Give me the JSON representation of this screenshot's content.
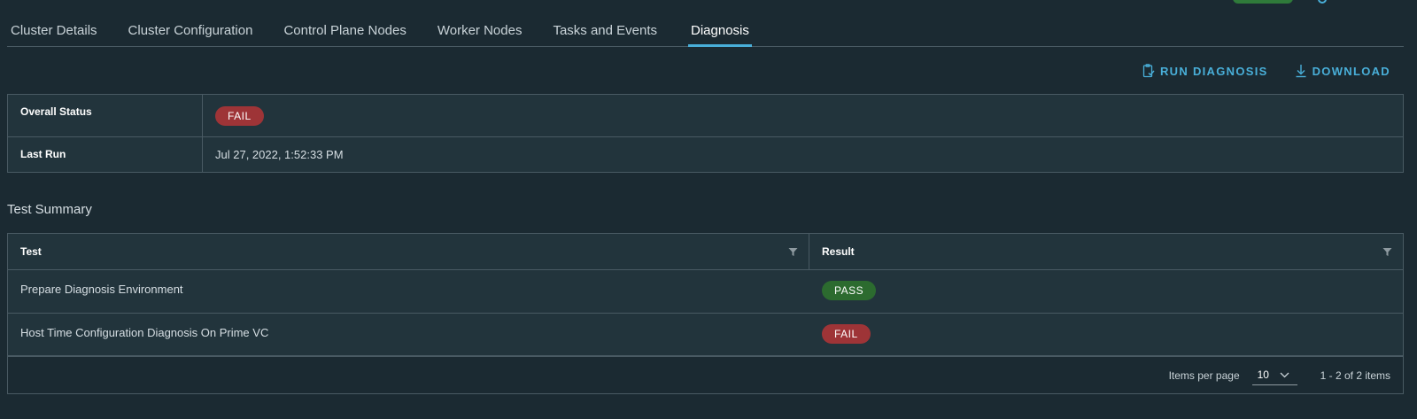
{
  "tabs": [
    {
      "label": "Cluster Details"
    },
    {
      "label": "Cluster Configuration"
    },
    {
      "label": "Control Plane Nodes"
    },
    {
      "label": "Worker Nodes"
    },
    {
      "label": "Tasks and Events"
    },
    {
      "label": "Diagnosis",
      "active": true
    }
  ],
  "actions": {
    "run_diagnosis": "RUN DIAGNOSIS",
    "download": "DOWNLOAD"
  },
  "status": {
    "overall_label": "Overall Status",
    "overall_value": "FAIL",
    "last_run_label": "Last Run",
    "last_run_value": "Jul 27, 2022, 1:52:33 PM"
  },
  "test_summary": {
    "title": "Test Summary",
    "columns": [
      "Test",
      "Result"
    ],
    "rows": [
      {
        "test": "Prepare Diagnosis Environment",
        "result": "PASS"
      },
      {
        "test": "Host Time Configuration Diagnosis On Prime VC",
        "result": "FAIL"
      }
    ],
    "footer": {
      "items_per_page_label": "Items per page",
      "items_per_page_value": "10",
      "range": "1 - 2 of 2 items"
    }
  },
  "colors": {
    "background": "#1b2a32",
    "accent": "#49afd9",
    "fail": "#9e3437",
    "pass": "#2c6b2f"
  }
}
